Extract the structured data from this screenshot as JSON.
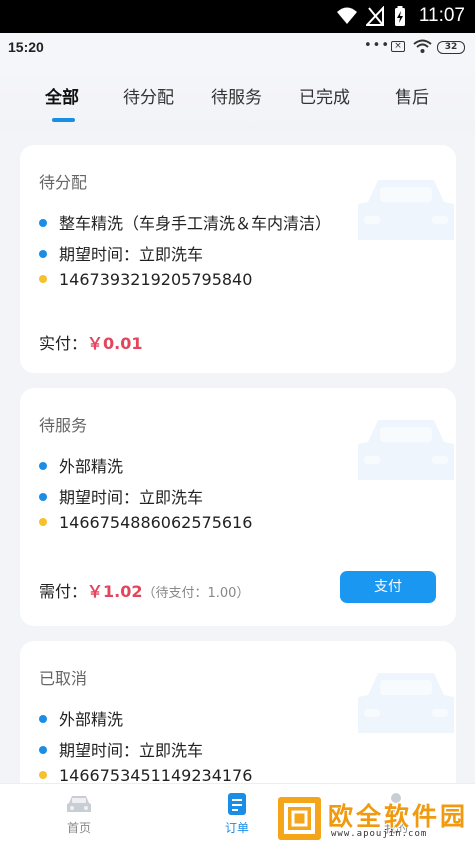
{
  "system_bar": {
    "time": "11:07"
  },
  "app_status": {
    "time": "15:20",
    "dots": "•••",
    "battery": "32"
  },
  "tabs": [
    {
      "label": "全部",
      "active": true
    },
    {
      "label": "待分配",
      "active": false
    },
    {
      "label": "待服务",
      "active": false
    },
    {
      "label": "已完成",
      "active": false
    },
    {
      "label": "售后",
      "active": false
    }
  ],
  "orders": [
    {
      "status": "待分配",
      "service": "整车精洗（车身手工清洗＆车内清洁）",
      "expected_time": "期望时间：立即洗车",
      "order_no": "1467393219205795840",
      "pay_label": "实付：",
      "amount": "￥0.01"
    },
    {
      "status": "待服务",
      "service": "外部精洗",
      "expected_time": "期望时间：立即洗车",
      "order_no": "1466754886062575616",
      "pay_label": "需付：",
      "amount": "￥1.02",
      "note": "（待支付：1.00）",
      "button": "支付"
    },
    {
      "status": "已取消",
      "service": "外部精洗",
      "expected_time": "期望时间：立即洗车",
      "order_no": "1466753451149234176"
    }
  ],
  "bottom_nav": [
    {
      "label": "首页",
      "icon": "car-icon",
      "active": false
    },
    {
      "label": "订单",
      "icon": "order-icon",
      "active": true
    },
    {
      "label": "我的",
      "icon": "profile-icon",
      "active": false
    }
  ],
  "watermark": {
    "text": "欧全软件园",
    "url": "www.apoujin.com"
  },
  "colors": {
    "accent": "#1a8ee6",
    "price": "#e2455c",
    "dot_yellow": "#f7c12c"
  }
}
